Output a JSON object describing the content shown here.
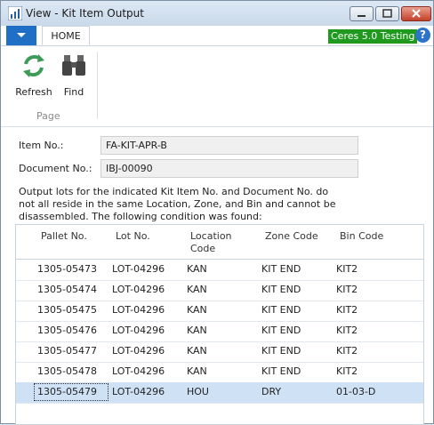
{
  "window": {
    "title": "View - Kit Item Output"
  },
  "ribbon": {
    "tabs": [
      {
        "label": "HOME"
      }
    ],
    "company": "Ceres 5.0 Testing",
    "buttons": [
      {
        "label": "Refresh"
      },
      {
        "label": "Find"
      }
    ],
    "group_label": "Page"
  },
  "form": {
    "item_no_label": "Item No.:",
    "item_no_value": "FA-KIT-APR-B",
    "document_no_label": "Document No.:",
    "document_no_value": "IBJ-00090",
    "message_lines": [
      "Output lots for the indicated Kit Item No. and Document No. do",
      "not all reside in the same Location, Zone, and Bin and cannot be",
      "disassembled. The following condition was found:"
    ]
  },
  "table": {
    "columns": [
      "Pallet No.",
      "Lot No.",
      "Location",
      "Code",
      "Zone Code",
      "Bin Code"
    ],
    "rows": [
      [
        "1305-05473",
        "LOT-04296",
        "KAN",
        "KIT END",
        "KIT2"
      ],
      [
        "1305-05474",
        "LOT-04296",
        "KAN",
        "KIT END",
        "KIT2"
      ],
      [
        "1305-05475",
        "LOT-04296",
        "KAN",
        "KIT END",
        "KIT2"
      ],
      [
        "1305-05476",
        "LOT-04296",
        "KAN",
        "KIT END",
        "KIT2"
      ],
      [
        "1305-05477",
        "LOT-04296",
        "KAN",
        "KIT END",
        "KIT2"
      ],
      [
        "1305-05478",
        "LOT-04296",
        "KAN",
        "KIT END",
        "KIT2"
      ],
      [
        "1305-05479",
        "LOT-04296",
        "HOU",
        "DRY",
        "01-03-D"
      ]
    ]
  },
  "colors": {
    "accent": "#1f6fc5",
    "company_badge": "#1f9a1f",
    "selected_row": "#cfe1f5"
  }
}
